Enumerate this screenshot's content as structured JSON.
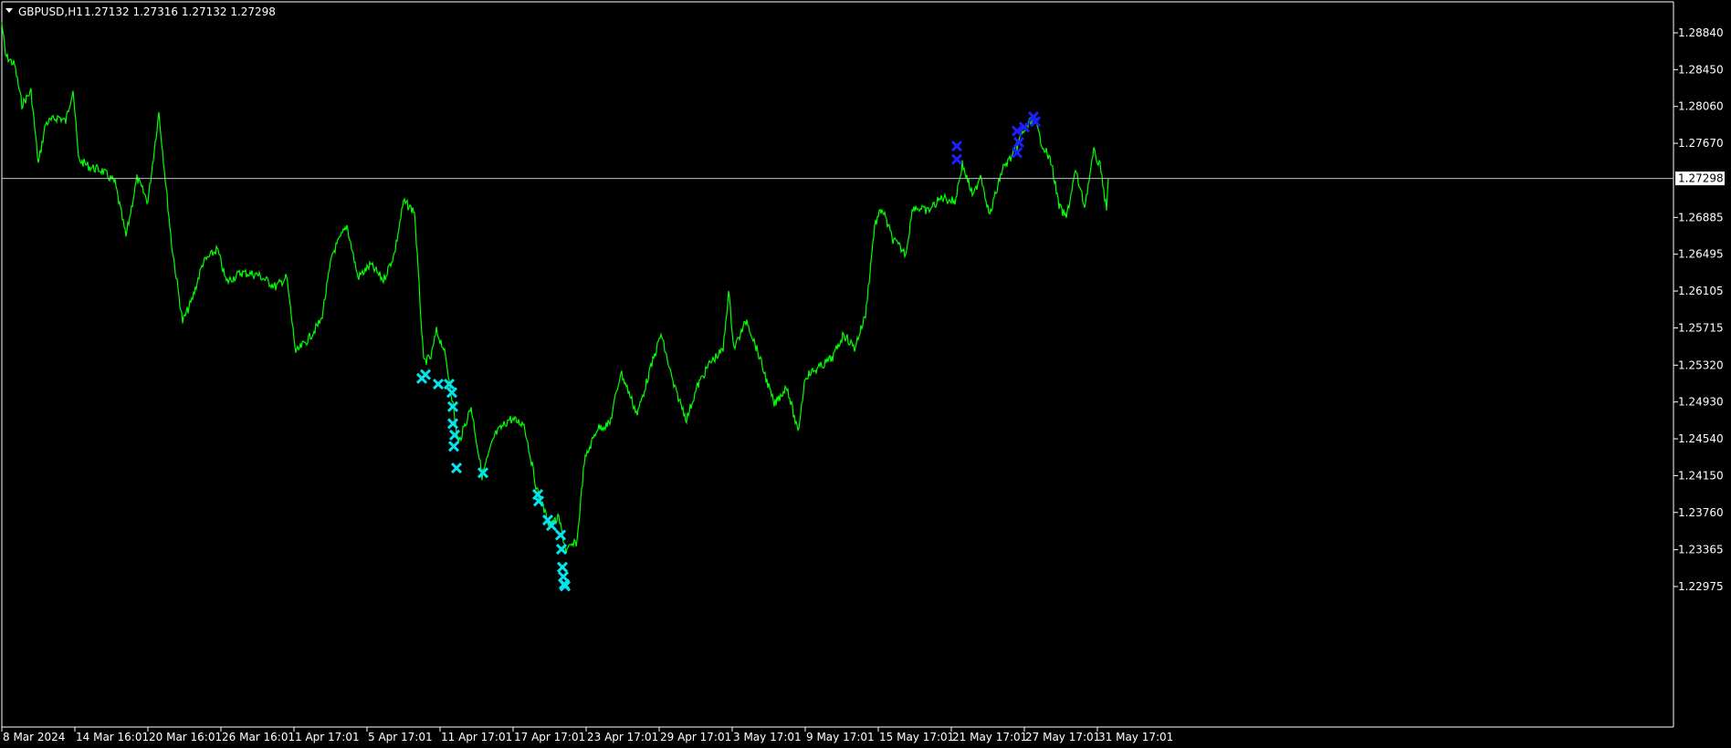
{
  "window": {
    "symbol_title": "GBPUSD,H1",
    "ohlc": "1.27132 1.27316 1.27132 1.27298"
  },
  "colors": {
    "background": "#000000",
    "price_line": "#00ff00",
    "axis": "#ffffff",
    "current_price_line": "#c0c0c0",
    "sell_marker": "#00e5ee",
    "buy_marker": "#1e1eff"
  },
  "chart_data": {
    "type": "line",
    "title": "GBPUSD,H1",
    "grid": false,
    "current_price": 1.27298,
    "current_price_label": "1.27298",
    "y_ticks": [
      1.2884,
      1.2845,
      1.2806,
      1.2767,
      1.26885,
      1.26495,
      1.26105,
      1.25715,
      1.2532,
      1.2493,
      1.2454,
      1.2415,
      1.2376,
      1.23365,
      1.22975
    ],
    "y_tick_labels": [
      "1.28840",
      "1.28450",
      "1.28060",
      "1.27670",
      "1.26885",
      "1.26495",
      "1.26105",
      "1.25715",
      "1.25320",
      "1.24930",
      "1.24540",
      "1.24150",
      "1.23760",
      "1.23365",
      "1.22975"
    ],
    "x_tick_labels": [
      "8 Mar 2024",
      "14 Mar 16:01",
      "20 Mar 16:01",
      "26 Mar 16:01",
      "1 Apr 17:01",
      "5 Apr 17:01",
      "11 Apr 17:01",
      "17 Apr 17:01",
      "23 Apr 17:01",
      "29 Apr 17:01",
      "3 May 17:01",
      "9 May 17:01",
      "15 May 17:01",
      "21 May 17:01",
      "27 May 17:01",
      "31 May 17:01"
    ],
    "series": [
      {
        "values": [
          {
            "t": 0,
            "v": 1.2895
          },
          {
            "t": 4,
            "v": 1.286
          },
          {
            "t": 14,
            "v": 1.285
          },
          {
            "t": 22,
            "v": 1.2808
          },
          {
            "t": 32,
            "v": 1.2822
          },
          {
            "t": 40,
            "v": 1.2745
          },
          {
            "t": 48,
            "v": 1.2788
          },
          {
            "t": 62,
            "v": 1.2795
          },
          {
            "t": 70,
            "v": 1.279
          },
          {
            "t": 78,
            "v": 1.2825
          },
          {
            "t": 84,
            "v": 1.275
          },
          {
            "t": 96,
            "v": 1.2742
          },
          {
            "t": 110,
            "v": 1.2738
          },
          {
            "t": 124,
            "v": 1.2725
          },
          {
            "t": 136,
            "v": 1.2668
          },
          {
            "t": 148,
            "v": 1.273
          },
          {
            "t": 160,
            "v": 1.2705
          },
          {
            "t": 172,
            "v": 1.28
          },
          {
            "t": 178,
            "v": 1.274
          },
          {
            "t": 186,
            "v": 1.266
          },
          {
            "t": 198,
            "v": 1.2578
          },
          {
            "t": 208,
            "v": 1.26
          },
          {
            "t": 220,
            "v": 1.264
          },
          {
            "t": 236,
            "v": 1.2655
          },
          {
            "t": 246,
            "v": 1.262
          },
          {
            "t": 262,
            "v": 1.263
          },
          {
            "t": 280,
            "v": 1.2628
          },
          {
            "t": 300,
            "v": 1.2615
          },
          {
            "t": 312,
            "v": 1.2625
          },
          {
            "t": 322,
            "v": 1.2545
          },
          {
            "t": 336,
            "v": 1.256
          },
          {
            "t": 350,
            "v": 1.258
          },
          {
            "t": 362,
            "v": 1.265
          },
          {
            "t": 378,
            "v": 1.268
          },
          {
            "t": 390,
            "v": 1.2625
          },
          {
            "t": 404,
            "v": 1.2638
          },
          {
            "t": 418,
            "v": 1.2622
          },
          {
            "t": 430,
            "v": 1.265
          },
          {
            "t": 440,
            "v": 1.2705
          },
          {
            "t": 452,
            "v": 1.2695
          },
          {
            "t": 458,
            "v": 1.26
          },
          {
            "t": 462,
            "v": 1.2535
          },
          {
            "t": 470,
            "v": 1.254
          },
          {
            "t": 476,
            "v": 1.2568
          },
          {
            "t": 484,
            "v": 1.255
          },
          {
            "t": 492,
            "v": 1.2505
          },
          {
            "t": 500,
            "v": 1.2448
          },
          {
            "t": 514,
            "v": 1.2488
          },
          {
            "t": 526,
            "v": 1.2415
          },
          {
            "t": 540,
            "v": 1.2458
          },
          {
            "t": 556,
            "v": 1.2475
          },
          {
            "t": 572,
            "v": 1.247
          },
          {
            "t": 586,
            "v": 1.24
          },
          {
            "t": 600,
            "v": 1.2362
          },
          {
            "t": 610,
            "v": 1.237
          },
          {
            "t": 618,
            "v": 1.2335
          },
          {
            "t": 630,
            "v": 1.2345
          },
          {
            "t": 638,
            "v": 1.243
          },
          {
            "t": 652,
            "v": 1.2465
          },
          {
            "t": 666,
            "v": 1.247
          },
          {
            "t": 678,
            "v": 1.2525
          },
          {
            "t": 696,
            "v": 1.248
          },
          {
            "t": 708,
            "v": 1.252
          },
          {
            "t": 722,
            "v": 1.2565
          },
          {
            "t": 736,
            "v": 1.251
          },
          {
            "t": 750,
            "v": 1.2475
          },
          {
            "t": 762,
            "v": 1.251
          },
          {
            "t": 776,
            "v": 1.2535
          },
          {
            "t": 790,
            "v": 1.2548
          },
          {
            "t": 796,
            "v": 1.261
          },
          {
            "t": 802,
            "v": 1.255
          },
          {
            "t": 816,
            "v": 1.258
          },
          {
            "t": 830,
            "v": 1.254
          },
          {
            "t": 846,
            "v": 1.249
          },
          {
            "t": 860,
            "v": 1.251
          },
          {
            "t": 872,
            "v": 1.246
          },
          {
            "t": 880,
            "v": 1.252
          },
          {
            "t": 896,
            "v": 1.253
          },
          {
            "t": 910,
            "v": 1.254
          },
          {
            "t": 922,
            "v": 1.2565
          },
          {
            "t": 934,
            "v": 1.255
          },
          {
            "t": 946,
            "v": 1.2585
          },
          {
            "t": 956,
            "v": 1.268
          },
          {
            "t": 964,
            "v": 1.2698
          },
          {
            "t": 976,
            "v": 1.2665
          },
          {
            "t": 990,
            "v": 1.265
          },
          {
            "t": 998,
            "v": 1.27
          },
          {
            "t": 1014,
            "v": 1.2695
          },
          {
            "t": 1030,
            "v": 1.271
          },
          {
            "t": 1044,
            "v": 1.2705
          },
          {
            "t": 1052,
            "v": 1.2745
          },
          {
            "t": 1064,
            "v": 1.271
          },
          {
            "t": 1072,
            "v": 1.2735
          },
          {
            "t": 1082,
            "v": 1.269
          },
          {
            "t": 1096,
            "v": 1.274
          },
          {
            "t": 1108,
            "v": 1.2755
          },
          {
            "t": 1118,
            "v": 1.2778
          },
          {
            "t": 1130,
            "v": 1.2795
          },
          {
            "t": 1138,
            "v": 1.277
          },
          {
            "t": 1150,
            "v": 1.2745
          },
          {
            "t": 1158,
            "v": 1.27
          },
          {
            "t": 1166,
            "v": 1.2688
          },
          {
            "t": 1176,
            "v": 1.2738
          },
          {
            "t": 1186,
            "v": 1.27
          },
          {
            "t": 1196,
            "v": 1.2758
          },
          {
            "t": 1204,
            "v": 1.274
          },
          {
            "t": 1210,
            "v": 1.2695
          },
          {
            "t": 1212,
            "v": 1.27298
          }
        ]
      }
    ],
    "markers": {
      "sell": [
        {
          "t": 460,
          "v": 1.2518
        },
        {
          "t": 464,
          "v": 1.2522
        },
        {
          "t": 478,
          "v": 1.2512
        },
        {
          "t": 490,
          "v": 1.2512
        },
        {
          "t": 493,
          "v": 1.2503
        },
        {
          "t": 494,
          "v": 1.2488
        },
        {
          "t": 494,
          "v": 1.247
        },
        {
          "t": 496,
          "v": 1.2458
        },
        {
          "t": 495,
          "v": 1.2446
        },
        {
          "t": 498,
          "v": 1.2423
        },
        {
          "t": 527,
          "v": 1.2418
        },
        {
          "t": 587,
          "v": 1.2395
        },
        {
          "t": 588,
          "v": 1.2388
        },
        {
          "t": 598,
          "v": 1.2368
        },
        {
          "t": 602,
          "v": 1.2362
        },
        {
          "t": 612,
          "v": 1.2352
        },
        {
          "t": 613,
          "v": 1.2337
        },
        {
          "t": 614,
          "v": 1.2318
        },
        {
          "t": 615,
          "v": 1.2308
        },
        {
          "t": 616,
          "v": 1.23
        },
        {
          "t": 617,
          "v": 1.2298
        }
      ],
      "buy": [
        {
          "t": 1046,
          "v": 1.2764
        },
        {
          "t": 1046,
          "v": 1.275
        },
        {
          "t": 1112,
          "v": 1.278
        },
        {
          "t": 1114,
          "v": 1.2768
        },
        {
          "t": 1112,
          "v": 1.2757
        },
        {
          "t": 1120,
          "v": 1.2784
        },
        {
          "t": 1130,
          "v": 1.2795
        },
        {
          "t": 1132,
          "v": 1.279
        }
      ]
    }
  }
}
